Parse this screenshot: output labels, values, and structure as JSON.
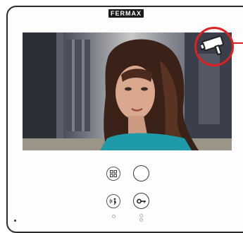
{
  "panel": {
    "brand": "FERMAX"
  },
  "icons": {
    "camera": "surveillance-camera-icon",
    "menu": "grid-menu-icon",
    "round_button": "circle-button-icon",
    "audio": "audio-call-icon",
    "door": "door-key-icon"
  },
  "colors": {
    "highlight": "#e02020",
    "frame": "#2b2b2b",
    "brand_bg": "#1b1b1b"
  }
}
